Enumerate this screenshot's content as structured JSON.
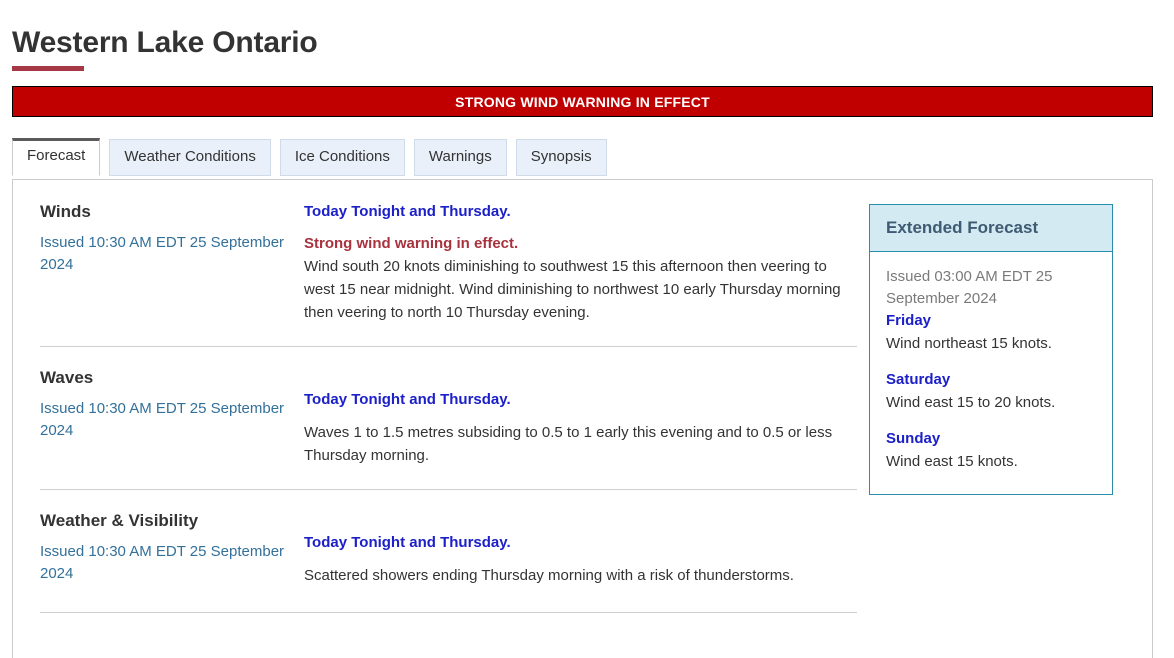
{
  "header": {
    "title": "Western Lake Ontario",
    "accent_color": "#a53844"
  },
  "warning_banner": {
    "text": "STRONG WIND WARNING IN EFFECT",
    "background_color": "#c00000",
    "text_color": "#ffffff"
  },
  "tabs": [
    {
      "label": "Forecast",
      "active": true
    },
    {
      "label": "Weather Conditions",
      "active": false
    },
    {
      "label": "Ice Conditions",
      "active": false
    },
    {
      "label": "Warnings",
      "active": false
    },
    {
      "label": "Synopsis",
      "active": false
    }
  ],
  "forecast_sections": [
    {
      "heading": "Winds",
      "issued": "Issued 10:30 AM EDT 25 September 2024",
      "period_heading": "Today Tonight and Thursday.",
      "alert": "Strong wind warning in effect.",
      "body": "Wind south 20 knots diminishing to southwest 15 this afternoon then veering to west 15 near midnight. Wind diminishing to northwest 10 early Thursday morning then veering to north 10 Thursday evening."
    },
    {
      "heading": "Waves",
      "issued": "Issued 10:30 AM EDT 25 September 2024",
      "period_heading": "Today Tonight and Thursday.",
      "alert": "",
      "body": "Waves 1 to 1.5 metres subsiding to 0.5 to 1 early this evening and to 0.5 or less Thursday morning."
    },
    {
      "heading": "Weather & Visibility",
      "issued": "Issued 10:30 AM EDT 25 September 2024",
      "period_heading": "Today Tonight and Thursday.",
      "alert": "",
      "body": "Scattered showers ending Thursday morning with a risk of thunderstorms."
    }
  ],
  "extended_forecast": {
    "title": "Extended Forecast",
    "issued": "Issued 03:00 AM EDT 25 September 2024",
    "days": [
      {
        "day": "Friday",
        "description": "Wind northeast 15 knots."
      },
      {
        "day": "Saturday",
        "description": "Wind east 15 to 20 knots."
      },
      {
        "day": "Sunday",
        "description": "Wind east 15 knots."
      }
    ],
    "header_background_color": "#d3eaf2",
    "border_color": "#2b8cab"
  }
}
